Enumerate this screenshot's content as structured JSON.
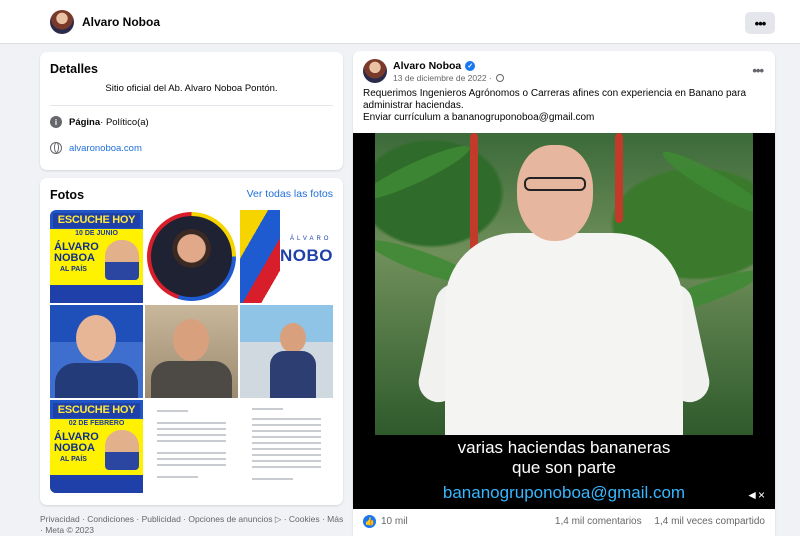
{
  "header": {
    "name": "Alvaro Noboa",
    "more_label": "•••"
  },
  "details": {
    "title": "Detalles",
    "description": "Sitio oficial del Ab. Alvaro Noboa Pontón.",
    "page_label": "Página",
    "page_category": " · Político(a)",
    "website": "alvaronoboa.com"
  },
  "photos": {
    "title": "Fotos",
    "see_all": "Ver todas las fotos",
    "poster1": {
      "header": "ESCUCHE HOY",
      "date": "10 DE JUNIO",
      "name": "ÁLVARO NOBOA",
      "line": "AL PAÍS"
    },
    "poster2": {
      "header": "ESCUCHE HOY",
      "date": "02 DE FEBRERO",
      "name": "ÁLVARO NOBOA",
      "line": "AL PAÍS"
    },
    "logo": {
      "small": "ÁLVARO",
      "big": "NOBO"
    }
  },
  "footer": {
    "text": "Privacidad · Condiciones · Publicidad · Opciones de anuncios ▷ · Cookies · Más · Meta © 2023"
  },
  "post": {
    "author": "Alvaro Noboa",
    "date": "13 de diciembre de 2022 ·",
    "text_line1": "Requerimos Ingenieros Agrónomos o Carreras afines con experiencia en Banano para administrar haciendas.",
    "text_line2": "Enviar currículum a bananogruponoboa@gmail.com",
    "caption_line1": "varias haciendas bananeras",
    "caption_line2": "que son parte",
    "caption_email": "bananogruponoboa@gmail.com",
    "likes": "10 mil",
    "comments": "1,4 mil comentarios",
    "shares": "1,4 mil veces compartido"
  },
  "colors": {
    "link": "#216fdb",
    "accent": "#1877f2",
    "caption_email": "#37b6ff"
  }
}
